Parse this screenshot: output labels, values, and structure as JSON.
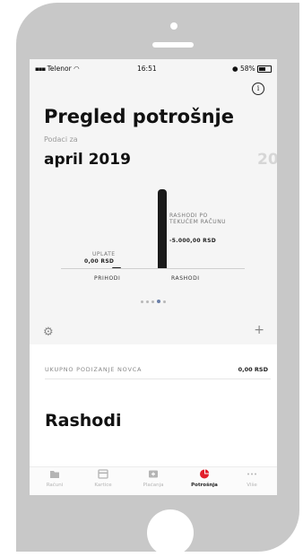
{
  "status": {
    "carrier": "Telenor",
    "time": "16:51",
    "battery": "58%"
  },
  "page": {
    "title": "Pregled potrošnje",
    "subtitle": "Podaci za",
    "month": "april 2019",
    "next_month_peek": "20"
  },
  "chart_data": {
    "type": "bar",
    "categories": [
      "PRIHODI",
      "RASHODI"
    ],
    "values": [
      0.0,
      -5000.0
    ],
    "bar_labels": [
      {
        "label": "UPLATE",
        "value": "0,00 RSD"
      },
      {
        "label": "RASHODI PO TEKUĆEM RAČUNU",
        "value": "-5.000,00 RSD"
      }
    ]
  },
  "pager": {
    "count": 5,
    "active": 3
  },
  "withdrawal": {
    "label": "UKUPNO PODIZANJE NOVCA",
    "value": "0,00 RSD"
  },
  "section_title": "Rashodi",
  "tabs": [
    {
      "label": "Računi",
      "icon": "folder-icon",
      "active": false
    },
    {
      "label": "Kartice",
      "icon": "card-icon",
      "active": false
    },
    {
      "label": "Plaćanja",
      "icon": "payment-icon",
      "active": false
    },
    {
      "label": "Potrošnja",
      "icon": "pie-chart-icon",
      "active": true
    },
    {
      "label": "Više",
      "icon": "more-icon",
      "active": false
    }
  ],
  "colors": {
    "accent": "#e2202c",
    "bar": "#1a1a1a"
  }
}
